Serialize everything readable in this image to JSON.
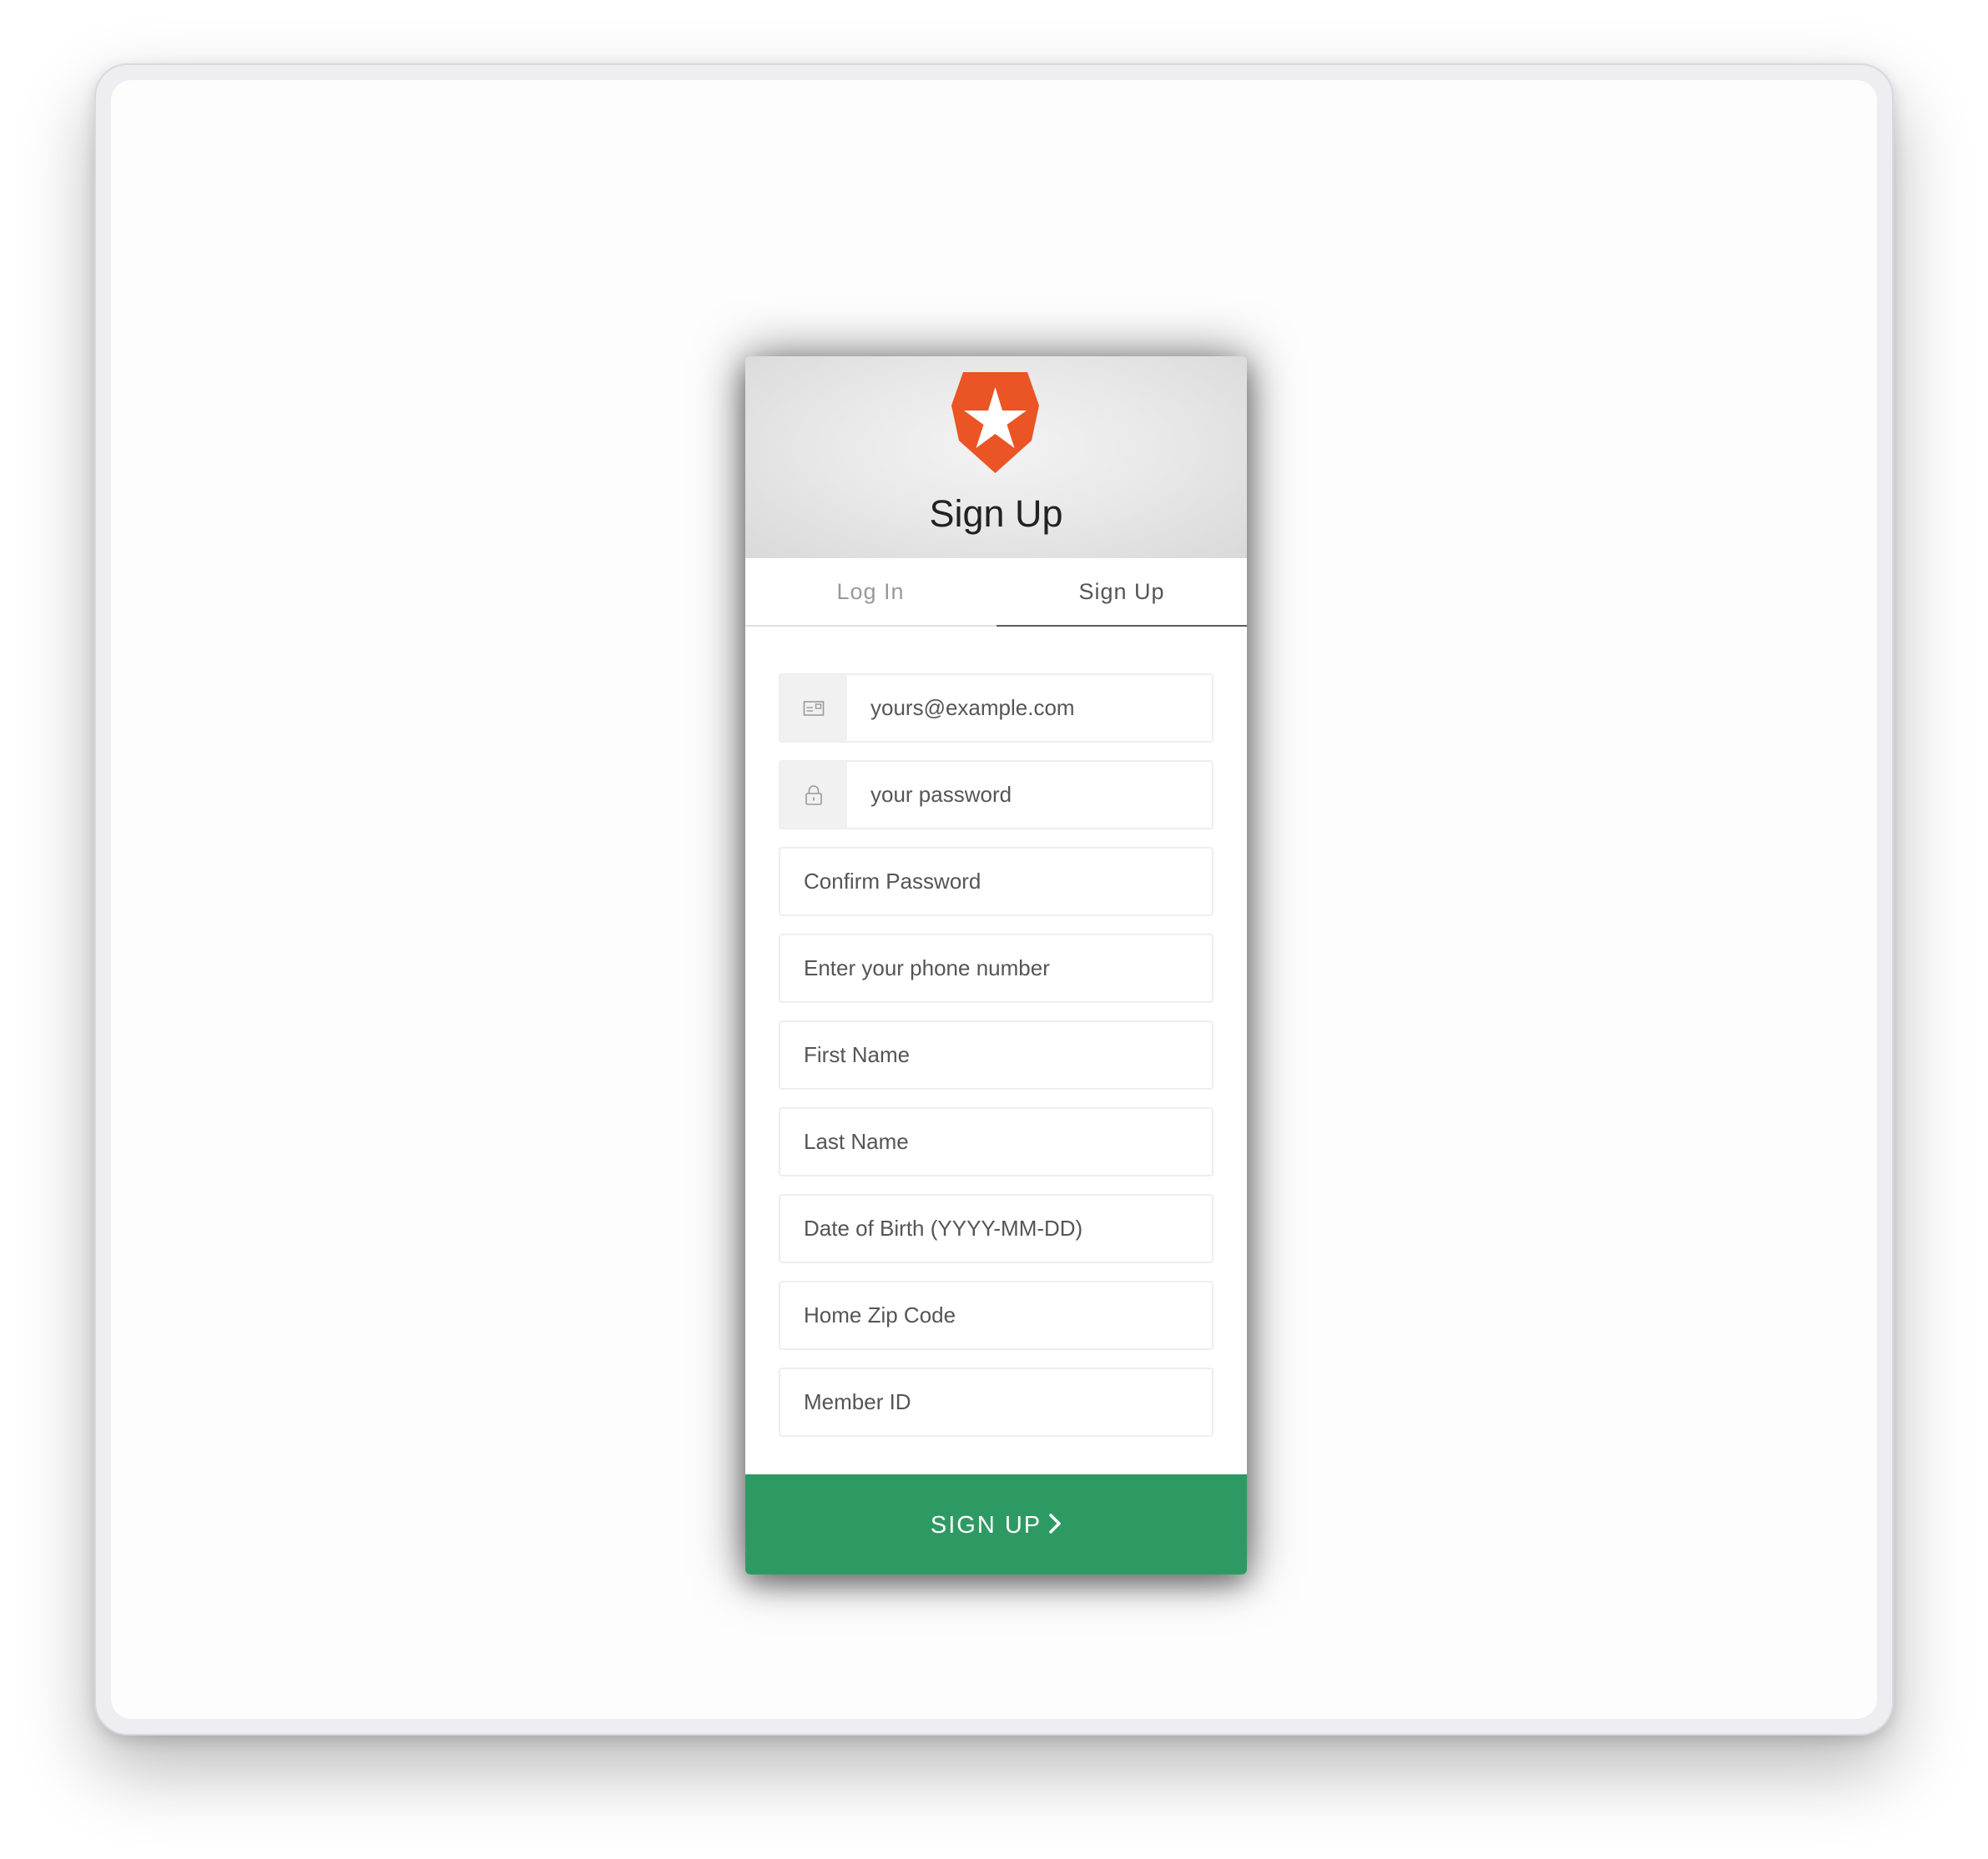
{
  "header": {
    "title": "Sign Up",
    "logo_icon": "auth0-shield-star-icon",
    "logo_color": "#eb5424"
  },
  "tabs": [
    {
      "label": "Log In",
      "active": false
    },
    {
      "label": "Sign Up",
      "active": true
    }
  ],
  "fields": {
    "email": {
      "placeholder": "yours@example.com",
      "icon": "envelope-icon",
      "value": ""
    },
    "password": {
      "placeholder": "your password",
      "icon": "lock-icon",
      "value": ""
    },
    "confirm_password": {
      "placeholder": "Confirm Password",
      "value": ""
    },
    "phone": {
      "placeholder": "Enter your phone number",
      "value": ""
    },
    "first_name": {
      "placeholder": "First Name",
      "value": ""
    },
    "last_name": {
      "placeholder": "Last Name",
      "value": ""
    },
    "dob": {
      "placeholder": "Date of Birth (YYYY-MM-DD)",
      "value": ""
    },
    "zip": {
      "placeholder": "Home Zip Code",
      "value": ""
    },
    "member_id": {
      "placeholder": "Member ID",
      "value": ""
    }
  },
  "submit": {
    "label": "SIGN UP",
    "icon": "chevron-right-icon",
    "color": "#2e9a63"
  }
}
